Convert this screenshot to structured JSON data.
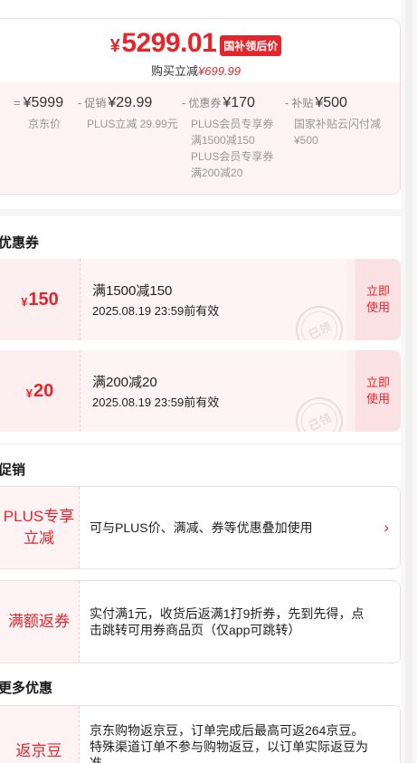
{
  "price": {
    "currency": "¥",
    "final_amount": "5299.01",
    "final_tag": "国补领后价",
    "save_label": "购买立减",
    "save_amount": "¥699.99",
    "breakdown": [
      {
        "op": "=",
        "label": "",
        "value": "¥5999",
        "sub": [
          "京东价"
        ]
      },
      {
        "op": "-",
        "label": "促销",
        "value": "¥29.99",
        "sub": [
          "PLUS立减 29.99元"
        ]
      },
      {
        "op": "-",
        "label": "优惠券",
        "value": "¥170",
        "sub": [
          "PLUS会员专享券",
          "满1500减150",
          "PLUS会员专享券",
          "满200减20"
        ]
      },
      {
        "op": "-",
        "label": "补贴",
        "value": "¥500",
        "sub": [
          "国家补贴云闪付减",
          "¥500"
        ]
      }
    ]
  },
  "coupons": {
    "title": "优惠券",
    "items": [
      {
        "currency": "¥",
        "amount": "150",
        "condition": "满1500减150",
        "expiry": "2025.08.19 23:59前有效",
        "stamp": "已领",
        "button": "立即使用"
      },
      {
        "currency": "¥",
        "amount": "20",
        "condition": "满200减20",
        "expiry": "2025.08.19 23:59前有效",
        "stamp": "已领",
        "button": "立即使用"
      }
    ]
  },
  "promotions": {
    "title": "促销",
    "items": [
      {
        "tag": "PLUS专享立减",
        "desc": "可与PLUS价、满减、券等优惠叠加使用",
        "chevron": "›"
      },
      {
        "tag": "满额返券",
        "desc": "实付满1元，收货后返满1打9折券，先到先得，点击跳转可用券商品页（仅app可跳转）"
      }
    ]
  },
  "more": {
    "title": "更多优惠",
    "items": [
      {
        "tag": "返京豆",
        "desc": "京东购物返京豆，订单完成后最高可返264京豆。特殊渠道订单不参与购物返豆，以订单实际返豆为准"
      }
    ]
  },
  "colors": {
    "accent": "#e4262c",
    "card_bg": "#fdeef0"
  }
}
